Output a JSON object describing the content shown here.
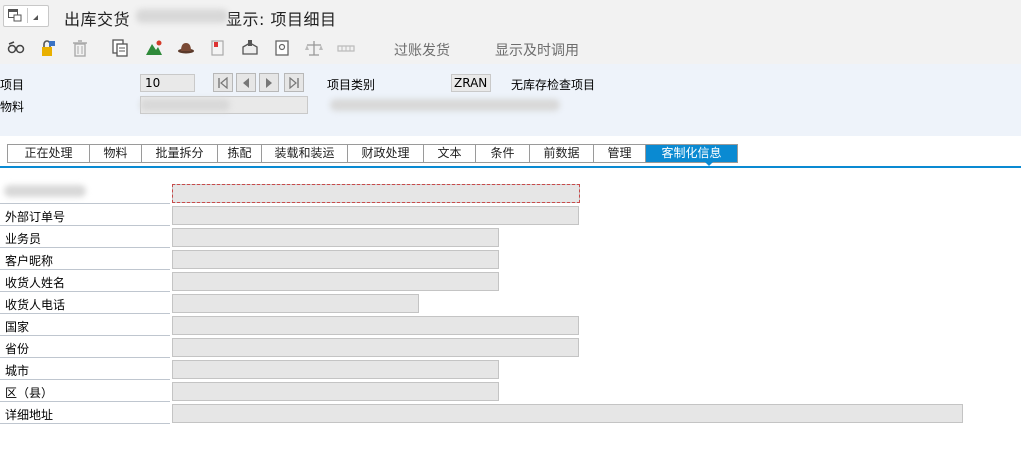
{
  "title_bar": {
    "title_prefix": "出库交货",
    "title_suffix": "显示: 项目细目"
  },
  "toolbar": {
    "post_goods_issue": "过账发货",
    "display_call": "显示及时调用"
  },
  "header": {
    "item_label": "项目",
    "item_value": "10",
    "item_category_label": "项目类别",
    "item_category_value": "ZRAN",
    "item_category_desc": "无库存检查项目",
    "material_label": "物料"
  },
  "tabs": [
    {
      "label": "正在处理"
    },
    {
      "label": "物料"
    },
    {
      "label": "批量拆分"
    },
    {
      "label": "拣配"
    },
    {
      "label": "装载和装运"
    },
    {
      "label": "财政处理"
    },
    {
      "label": "文本"
    },
    {
      "label": "条件"
    },
    {
      "label": "前数据"
    },
    {
      "label": "管理"
    },
    {
      "label": "客制化信息",
      "active": true
    }
  ],
  "custom_fields": [
    {
      "label": "",
      "value": ""
    },
    {
      "label": "外部订单号",
      "value": ""
    },
    {
      "label": "业务员",
      "value": ""
    },
    {
      "label": "客户昵称",
      "value": ""
    },
    {
      "label": "收货人姓名",
      "value": ""
    },
    {
      "label": "收货人电话",
      "value": ""
    },
    {
      "label": "国家",
      "value": ""
    },
    {
      "label": "省份",
      "value": ""
    },
    {
      "label": "城市",
      "value": ""
    },
    {
      "label": "区（县）",
      "value": ""
    },
    {
      "label": "详细地址",
      "value": ""
    }
  ]
}
